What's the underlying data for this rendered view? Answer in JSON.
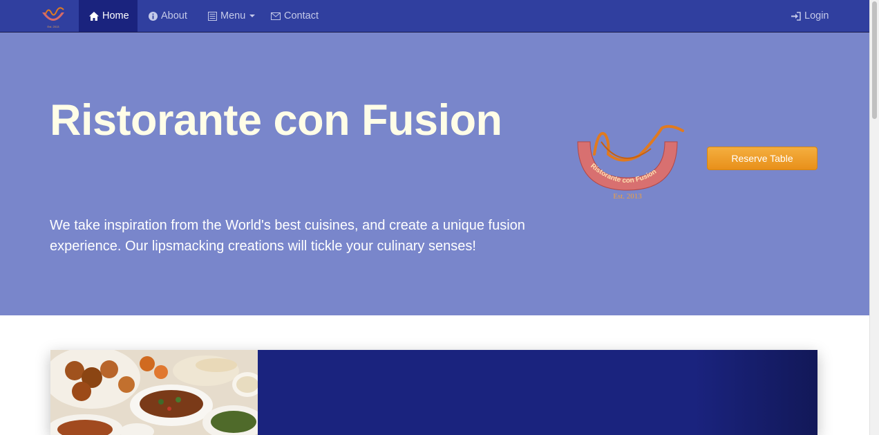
{
  "nav": {
    "home": "Home",
    "about": "About",
    "menu": "Menu",
    "contact": "Contact",
    "login": "Login"
  },
  "hero": {
    "title": "Ristorante con Fusion",
    "text": "We take inspiration from the World's best cuisines, and create a unique fusion experience. Our lipsmacking creations will tickle your culinary senses!",
    "reserve_label": "Reserve Table",
    "logo_text": "Ristorante con Fusion",
    "logo_est": "Est. 2013"
  },
  "colors": {
    "navbar": "#303f9f",
    "nav_active": "#1a237e",
    "jumbotron": "#7986cb",
    "accent_button": "#f0a030",
    "panel": "#1a237e"
  }
}
